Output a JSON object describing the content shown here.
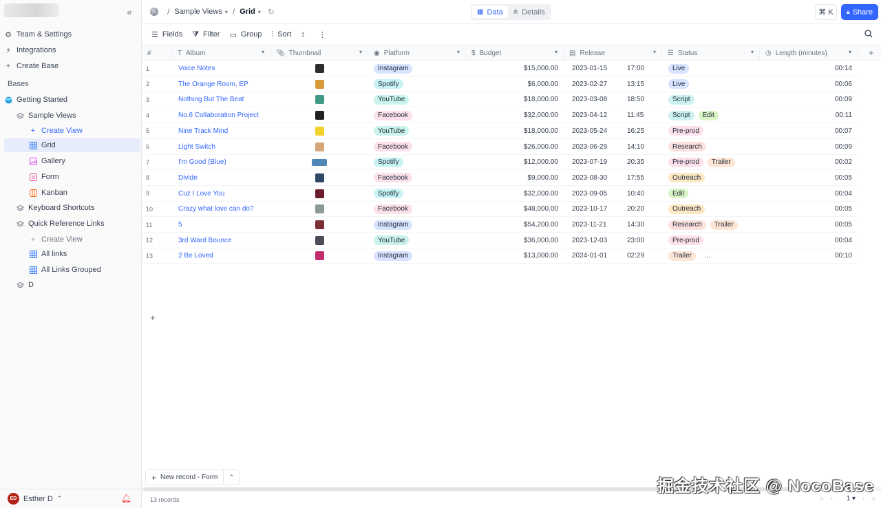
{
  "sidebar": {
    "collapse_icon": "double-chevron-left-icon",
    "top_items": [
      {
        "label": "Team & Settings",
        "icon": "gear-icon"
      },
      {
        "label": "Integrations",
        "icon": "plug-icon"
      },
      {
        "label": "Create Base",
        "icon": "plus-icon"
      }
    ],
    "section_label": "Bases",
    "tree": [
      {
        "label": "Getting Started",
        "icon": "base-icon"
      },
      {
        "label": "Sample Views",
        "icon": "table-icon"
      },
      {
        "label": "Create View",
        "icon": "plus-icon"
      },
      {
        "label": "Grid",
        "icon": "grid-icon"
      },
      {
        "label": "Gallery",
        "icon": "gallery-icon"
      },
      {
        "label": "Form",
        "icon": "form-icon"
      },
      {
        "label": "Kanban",
        "icon": "kanban-icon"
      },
      {
        "label": "Keyboard Shortcuts",
        "icon": "table-icon"
      },
      {
        "label": "Quick Reference Links",
        "icon": "table-icon"
      },
      {
        "label": "Create View",
        "icon": "plus-icon"
      },
      {
        "label": "All links",
        "icon": "grid-icon"
      },
      {
        "label": "All Links Grouped",
        "icon": "grid-icon"
      },
      {
        "label": "D",
        "icon": "table-icon"
      }
    ],
    "user": {
      "initials": "ED",
      "name": "Esther D"
    }
  },
  "topbar": {
    "breadcrumb_table": "Sample Views",
    "breadcrumb_view": "Grid",
    "tab_data": "Data",
    "tab_details": "Details",
    "cmdk": "⌘ K",
    "share": "Share"
  },
  "toolbar": {
    "fields": "Fields",
    "filter": "Filter",
    "group": "Group",
    "sort": "Sort"
  },
  "grid": {
    "columns": {
      "index": "#",
      "album": "Album",
      "thumbnail": "Thumbnail",
      "platform": "Platform",
      "budget": "Budget",
      "release": "Release",
      "status": "Status",
      "length": "Length (minutes)"
    },
    "rows": [
      {
        "n": "1",
        "album": "Voice Notes",
        "thumb": "#2b2b2b",
        "platform": "Instagram",
        "budget": "$15,000.00",
        "date": "2023-01-15",
        "time": "17:00",
        "status": [
          "Live"
        ],
        "length": "00:14"
      },
      {
        "n": "2",
        "album": "The Orange Room, EP",
        "thumb": "#d89a3a",
        "platform": "Spotify",
        "budget": "$6,000.00",
        "date": "2023-02-27",
        "time": "13:15",
        "status": [
          "Live"
        ],
        "length": "00:06"
      },
      {
        "n": "3",
        "album": "Nothing But The Beat",
        "thumb": "#3f9a86",
        "platform": "YouTube",
        "budget": "$18,000.00",
        "date": "2023-03-08",
        "time": "18:50",
        "status": [
          "Script"
        ],
        "length": "00:09"
      },
      {
        "n": "4",
        "album": "No.6 Collaboration Project",
        "thumb": "#202020",
        "platform": "Facebook",
        "budget": "$32,000.00",
        "date": "2023-04-12",
        "time": "11:45",
        "status": [
          "Script",
          "Edit"
        ],
        "length": "00:11"
      },
      {
        "n": "5",
        "album": "Nine Track Mind",
        "thumb": "#f2d12a",
        "platform": "YouTube",
        "budget": "$18,000.00",
        "date": "2023-05-24",
        "time": "16:25",
        "status": [
          "Pre-prod"
        ],
        "length": "00:07"
      },
      {
        "n": "6",
        "album": "Light Switch",
        "thumb": "#d7a77a",
        "platform": "Facebook",
        "budget": "$26,000.00",
        "date": "2023-06-29",
        "time": "14:10",
        "status": [
          "Research"
        ],
        "length": "00:09"
      },
      {
        "n": "7",
        "album": "I'm Good (Blue)",
        "thumb": "#4f86b8",
        "platform": "Spotify",
        "budget": "$12,000.00",
        "date": "2023-07-19",
        "time": "20:35",
        "status": [
          "Pre-prod",
          "Trailer"
        ],
        "length": "00:02"
      },
      {
        "n": "8",
        "album": "Divide",
        "thumb": "#2f4866",
        "platform": "Facebook",
        "budget": "$9,000.00",
        "date": "2023-08-30",
        "time": "17:55",
        "status": [
          "Outreach"
        ],
        "length": "00:05"
      },
      {
        "n": "9",
        "album": "Cuz I Love You",
        "thumb": "#6b1c2a",
        "platform": "Spotify",
        "budget": "$32,000.00",
        "date": "2023-09-05",
        "time": "10:40",
        "status": [
          "Edit"
        ],
        "length": "00:04"
      },
      {
        "n": "10",
        "album": "Crazy what love can do?",
        "thumb": "#8d9a96",
        "platform": "Facebook",
        "budget": "$48,000.00",
        "date": "2023-10-17",
        "time": "20:20",
        "status": [
          "Outreach"
        ],
        "length": "00:05"
      },
      {
        "n": "11",
        "album": "5",
        "thumb": "#7a2f36",
        "platform": "Instagram",
        "budget": "$54,200.00",
        "date": "2023-11-21",
        "time": "14:30",
        "status": [
          "Research",
          "Trailer"
        ],
        "length": "00:05"
      },
      {
        "n": "12",
        "album": "3rd Ward Bounce",
        "thumb": "#4a4d55",
        "platform": "YouTube",
        "budget": "$36,000.00",
        "date": "2023-12-03",
        "time": "23:00",
        "status": [
          "Pre-prod"
        ],
        "length": "00:04"
      },
      {
        "n": "13",
        "album": "2 Be Loved",
        "thumb": "#c22d6b",
        "platform": "Instagram",
        "budget": "$13,000.00",
        "date": "2024-01-01",
        "time": "02:29",
        "status": [
          "Trailer",
          "…"
        ],
        "length": "00:10"
      }
    ]
  },
  "colors": {
    "accent": "#3366ff",
    "Instagram": "#d7e3ff",
    "Spotify": "#c9f3f4",
    "YouTube": "#c9f3ec",
    "Facebook": "#fde1ea",
    "Live": "#d7e3ff",
    "Script": "#cbf2ef",
    "Edit": "#d9f5c6",
    "Pre-prod": "#fde1ea",
    "Research": "#fde1de",
    "Trailer": "#fde6d6",
    "Outreach": "#fde8c4",
    "…": "#ffffff"
  },
  "footer": {
    "new_record": "New record - Form",
    "records": "13 records",
    "page": "1"
  },
  "watermark": "掘金技术社区 @ NocoBase"
}
